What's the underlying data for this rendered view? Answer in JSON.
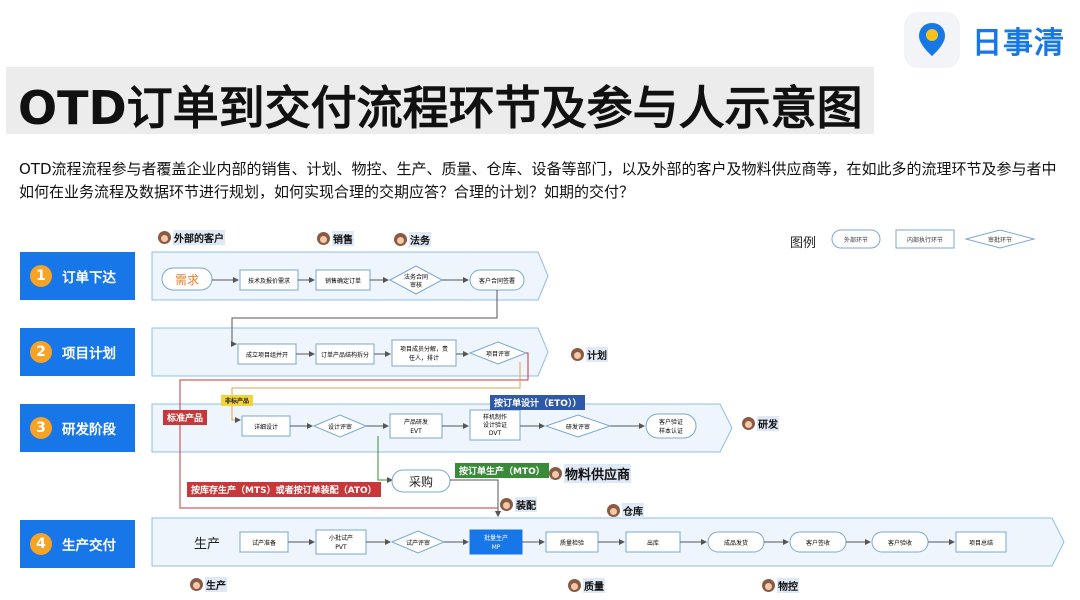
{
  "logo": {
    "text": "日事清"
  },
  "title": "OTD订单到交付流程环节及参与人示意图",
  "description": "OTD流程流程参与者覆盖企业内部的销售、计划、物控、生产、质量、仓库、设备等部门，以及外部的客户及物料供应商等，在如此多的流理环节及参与者中如何在业务流程及数据环节进行规划，如何实现合理的交期应答？合理的计划？如期的交付？",
  "legend": {
    "title": "图例",
    "items": [
      "外部环节",
      "内部执行环节",
      "审批环节"
    ]
  },
  "stages": [
    {
      "num": "1",
      "label": "订单下达"
    },
    {
      "num": "2",
      "label": "项目计划"
    },
    {
      "num": "3",
      "label": "研发阶段"
    },
    {
      "num": "4",
      "label": "生产交付"
    }
  ],
  "participants": {
    "customer": "外部的客户",
    "sales": "销售",
    "legal": "法务",
    "planning": "计划",
    "rd": "研发",
    "supplier": "物料供应商",
    "assembly": "装配",
    "warehouse": "仓库",
    "production": "生产",
    "quality": "质量",
    "material_control": "物控"
  },
  "tags": {
    "standard_product": "标准产品",
    "eto": "按订单设计（ETO））",
    "mto": "按订单生产（MTO）",
    "mts_ato": "按库存生产（MTS）或者按订单装配（ATO）",
    "nonstandard": "非标产品"
  },
  "nodes": {
    "s1_demand": "需求",
    "s1_n2": "技术及报价需求",
    "s1_n3": "销售确定订单",
    "s1_n4": [
      "法务合同",
      "审核"
    ],
    "s1_n5": "客户合同签署",
    "s2_n1": "成立项目组并开",
    "s2_n2": "订单产品结构拆分",
    "s2_n3": [
      "项目成员分解，责",
      "任人，排计"
    ],
    "s2_n4": "项目评审",
    "s3_n1": "详细设计",
    "s3_n2": "设计评审",
    "s3_n3": [
      "产品研发",
      "EVT"
    ],
    "s3_n4": [
      "样机制作",
      "设计验证",
      "DVT"
    ],
    "s3_n5": "研发评审",
    "s3_n6": [
      "客户验证",
      "样本认证"
    ],
    "purchase": "采购",
    "s4_label": "生产",
    "s4_n1": "试产准备",
    "s4_n2": [
      "小批试产",
      "PVT"
    ],
    "s4_n3": "试产评审",
    "s4_n4": [
      "批量生产",
      "MP"
    ],
    "s4_n5": "质量检验",
    "s4_n6": "出库",
    "s4_n7": "成品发货",
    "s4_n8": "客户签收",
    "s4_n9": "客户验收",
    "s4_n10": "项目总结"
  },
  "colors": {
    "accent": "#1877e8",
    "stage_num": "#f7a325",
    "lane_fill": "#eef5fd",
    "lane_stroke": "#8fbde9",
    "red_tag": "#c8373a",
    "blue_tag": "#2d59a8",
    "green_tag": "#3b8a3a",
    "demand_orange": "#e0802a"
  }
}
